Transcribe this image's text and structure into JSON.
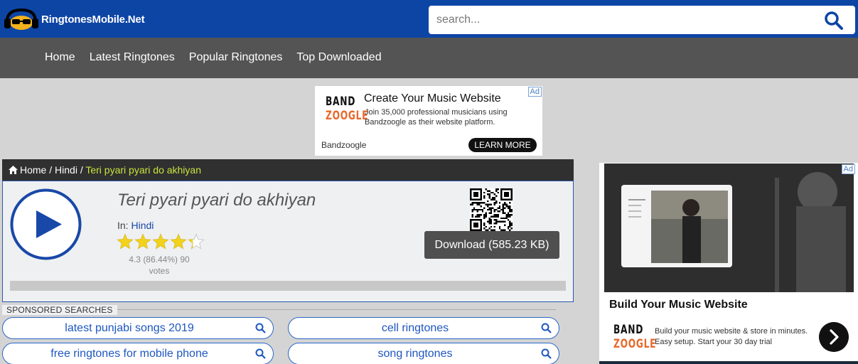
{
  "header": {
    "logo_text": "RingtonesMobile.Net",
    "search_placeholder": "search..."
  },
  "nav": {
    "items": [
      "Home",
      "Latest Ringtones",
      "Popular Ringtones",
      "Top Downloaded"
    ]
  },
  "ad_top": {
    "badge": "Ad",
    "logo_line1": "BAND",
    "logo_line2": "ZOOGLE",
    "title": "Create Your Music Website",
    "body": "Join 35,000 professional musicians using Bandzoogle as their website platform.",
    "advertiser": "Bandzoogle",
    "cta": "LEARN MORE"
  },
  "breadcrumb": {
    "home": "Home",
    "sep": " / ",
    "category": "Hindi",
    "current": "Teri pyari pyari do akhiyan"
  },
  "ringtone": {
    "title": "Teri pyari pyari do akhiyan",
    "in_prefix": "In: ",
    "category": "Hindi",
    "rating_value": 4.3,
    "rating_max": 5,
    "rating_text": "4.3 (86.44%) 90 votes",
    "download_label": "Download (585.23 KB)"
  },
  "sponsored": {
    "label": "SPONSORED SEARCHES",
    "items": [
      "latest punjabi songs 2019",
      "cell ringtones",
      "free ringtones for mobile phone",
      "song ringtones"
    ]
  },
  "ad_side": {
    "badge": "Ad",
    "title": "Build Your Music Website",
    "logo_line1": "BAND",
    "logo_line2": "ZOOGLE",
    "body": "Build your music website & store in minutes. Easy setup. Start your 30 day trial"
  },
  "colors": {
    "header_bg": "#0d45a5",
    "nav_bg": "#545454",
    "accent_link": "#1e56bf",
    "star": "#f2d21c",
    "breadcrumb_current": "#c7e43e"
  }
}
